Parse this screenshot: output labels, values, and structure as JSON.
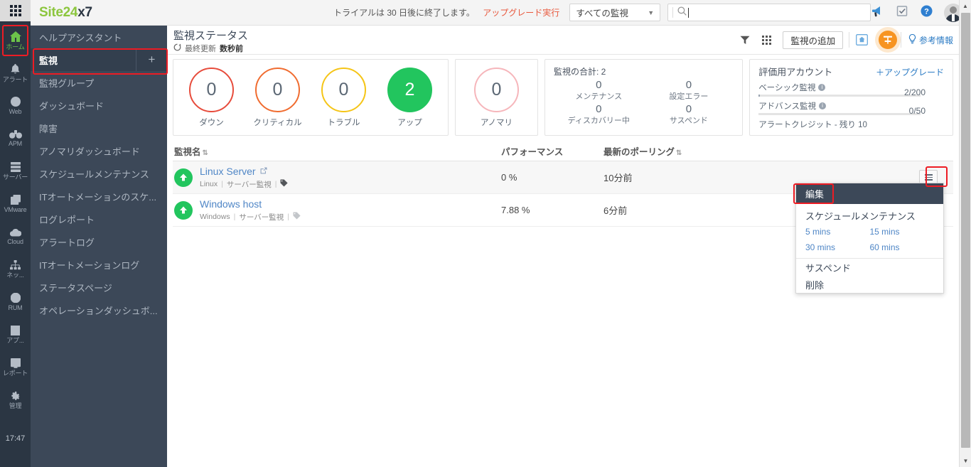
{
  "rail": {
    "grid_icon": "apps-grid-icon",
    "items": [
      {
        "label": "ホーム",
        "icon": "home-icon",
        "active": true
      },
      {
        "label": "アラート",
        "icon": "bell-icon",
        "active": false
      },
      {
        "label": "Web",
        "icon": "globe-icon",
        "active": false
      },
      {
        "label": "APM",
        "icon": "apm-binoculars-icon",
        "active": false
      },
      {
        "label": "サーバー",
        "icon": "server-icon",
        "active": false
      },
      {
        "label": "VMware",
        "icon": "vmware-layers-icon",
        "active": false
      },
      {
        "label": "Cloud",
        "icon": "cloud-icon",
        "active": false
      },
      {
        "label": "ネッ...",
        "icon": "network-icon",
        "active": false
      },
      {
        "label": "RUM",
        "icon": "rum-globe-icon",
        "active": false
      },
      {
        "label": "アプ...",
        "icon": "app-icon",
        "active": false
      },
      {
        "label": "レポート",
        "icon": "report-icon",
        "active": false
      },
      {
        "label": "管理",
        "icon": "gear-icon",
        "active": false
      }
    ],
    "clock": "17:47"
  },
  "header": {
    "logo_part1": "Site24",
    "logo_part2": "x7",
    "trial_text": "トライアルは 30 日後に終了します。",
    "upgrade_link": "アップグレード実行",
    "monitor_filter": "すべての監視",
    "search_value": "",
    "search_placeholder": "",
    "icons": [
      "announcement-icon",
      "tasks-icon",
      "help-icon",
      "avatar"
    ]
  },
  "nav": {
    "items": [
      {
        "label": "ヘルプアシスタント",
        "selected": false,
        "plus": false
      },
      {
        "label": "監視",
        "selected": true,
        "plus": true,
        "plus_label": "+"
      },
      {
        "label": "監視グループ",
        "selected": false,
        "plus": false
      },
      {
        "label": "ダッシュボード",
        "selected": false,
        "plus": false
      },
      {
        "label": "障害",
        "selected": false,
        "plus": false
      },
      {
        "label": "アノマリダッシュボード",
        "selected": false,
        "plus": false
      },
      {
        "label": "スケジュールメンテナンス",
        "selected": false,
        "plus": false
      },
      {
        "label": "ITオートメーションのスケ...",
        "selected": false,
        "plus": false
      },
      {
        "label": "ログレポート",
        "selected": false,
        "plus": false
      },
      {
        "label": "アラートログ",
        "selected": false,
        "plus": false
      },
      {
        "label": "ITオートメーションログ",
        "selected": false,
        "plus": false
      },
      {
        "label": "ステータスページ",
        "selected": false,
        "plus": false
      },
      {
        "label": "オペレーションダッシュボ...",
        "selected": false,
        "plus": false
      }
    ]
  },
  "page": {
    "title": "監視ステータス",
    "refresh_icon": "refresh-icon",
    "last_update_prefix": "最終更新",
    "last_update_value": "数秒前",
    "toolbar": {
      "filter_icon": "filter-icon",
      "grid_icon": "grid-view-icon",
      "add_monitor": "監視の追加",
      "home_icon": "home-box-icon",
      "highlight_icon": "inventory-icon",
      "reference_label": "参考情報",
      "reference_icon": "bulb-icon"
    }
  },
  "status": {
    "items": [
      {
        "count": "0",
        "label": "ダウン",
        "style": "down",
        "color": "#e74c3c"
      },
      {
        "count": "0",
        "label": "クリティカル",
        "style": "crit",
        "color": "#f06c30"
      },
      {
        "count": "0",
        "label": "トラブル",
        "style": "trouble",
        "color": "#f5c518"
      },
      {
        "count": "2",
        "label": "アップ",
        "style": "up",
        "color": "#22c55e"
      }
    ],
    "anomaly": {
      "count": "0",
      "label": "アノマリ",
      "color": "#f6b6bb"
    }
  },
  "totals": {
    "title": "監視の合計: 2",
    "cells": [
      {
        "num": "0",
        "label": "メンテナンス"
      },
      {
        "num": "0",
        "label": "設定エラー"
      },
      {
        "num": "0",
        "label": "ディスカバリー中"
      },
      {
        "num": "0",
        "label": "サスペンド"
      }
    ]
  },
  "account": {
    "title": "評価用アカウント",
    "upgrade": "＋アップグレード",
    "meters": [
      {
        "label": "ベーシック監視",
        "value": "2/200",
        "pct": 1
      },
      {
        "label": "アドバンス監視",
        "value": "0/50",
        "pct": 0
      }
    ],
    "credit": "アラートクレジット - 残り 10"
  },
  "table": {
    "columns": [
      {
        "label": "監視名",
        "sortable": true
      },
      {
        "label": "パフォーマンス",
        "sortable": false
      },
      {
        "label": "最新のポーリング",
        "sortable": true
      }
    ],
    "rows": [
      {
        "status": "up",
        "name": "Linux Server",
        "external_link": true,
        "os": "Linux",
        "type": "サーバー監視",
        "tag_icon": "tag-icon",
        "performance": "0 %",
        "last_poll": "10分前",
        "action_icon": "hamburger-menu-icon"
      },
      {
        "status": "up",
        "name": "Windows host",
        "external_link": false,
        "os": "Windows",
        "type": "サーバー監視",
        "tag_icon": "tag-icon",
        "performance": "7.88 %",
        "last_poll": "6分前",
        "action_icon": "hamburger-menu-icon"
      }
    ]
  },
  "context_menu": {
    "edit": "編集",
    "maintenance_title": "スケジュールメンテナンス",
    "times": [
      "5 mins",
      "15 mins",
      "30 mins",
      "60 mins"
    ],
    "items": [
      "サスペンド",
      "削除"
    ]
  },
  "scrollbar": {
    "up": "▲",
    "down": "▼"
  }
}
